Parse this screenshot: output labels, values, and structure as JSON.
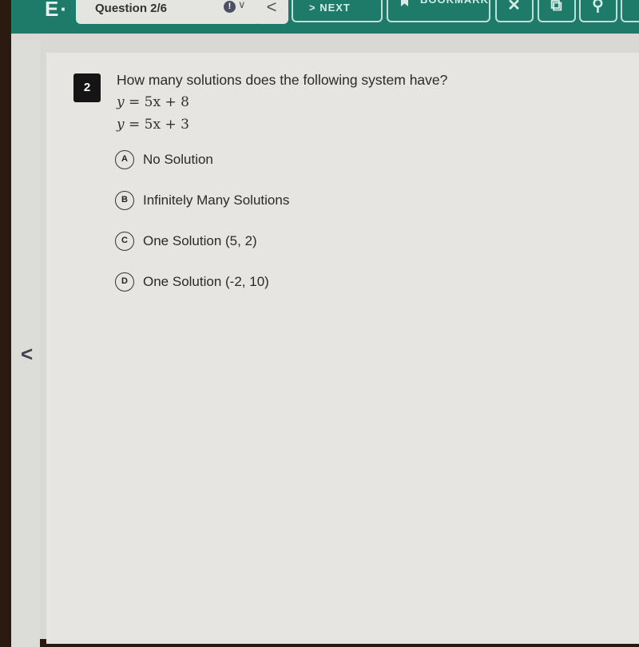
{
  "topbar": {
    "logo": "E·",
    "question_selector": {
      "label": "Question 2/6",
      "flag_icon": "!",
      "chevron": "∨"
    },
    "prev_label": "<",
    "next_label": "> NEXT",
    "bookmark_label": "BOOKMARK",
    "icons": [
      "close-icon",
      "export-icon",
      "search-icon",
      "more-icon"
    ]
  },
  "question": {
    "number": "2",
    "prompt": "How many solutions does the following system have?",
    "equations": [
      {
        "lhs": "y",
        "rhs": "= 5x + 8"
      },
      {
        "lhs": "y",
        "rhs": "= 5x + 3"
      }
    ],
    "options": [
      {
        "letter": "A",
        "text": "No Solution"
      },
      {
        "letter": "B",
        "text": "Infinitely Many Solutions"
      },
      {
        "letter": "C",
        "text": "One Solution (5, 2)"
      },
      {
        "letter": "D",
        "text": "One Solution (-2, 10)"
      }
    ]
  },
  "nav": {
    "back_arrow": "<"
  }
}
